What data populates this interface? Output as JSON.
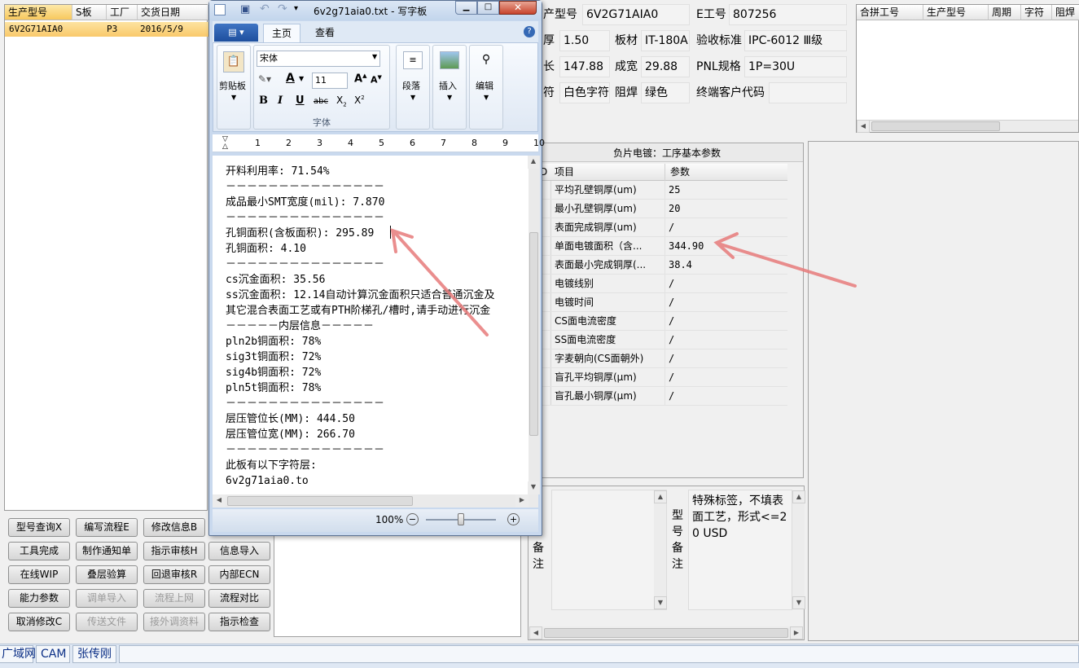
{
  "main_grid": {
    "headers": [
      "生产型号",
      "S板",
      "工厂",
      "交货日期"
    ],
    "row": {
      "model": "6V2G71AIA0",
      "s": "",
      "factory": "P3",
      "date": "2016/5/9"
    }
  },
  "buttons": [
    [
      "型号查询X",
      "编写流程E",
      "修改信息B",
      "帮助"
    ],
    [
      "工具完成",
      "制作通知单",
      "指示审核H",
      "信息导入"
    ],
    [
      "在线WIP",
      "叠层验算",
      "回退审核R",
      "内部ECN"
    ],
    [
      "能力参数",
      "调单导入",
      "流程上网",
      "流程对比"
    ],
    [
      "取消修改C",
      "传送文件",
      "接外调资料",
      "指示检查"
    ]
  ],
  "info_fields": {
    "prod_model_label": "产型号",
    "prod_model": "6V2G71AIA0",
    "e_no_label": "E工号",
    "e_no": "807256",
    "thick_label": "厚",
    "thick": "1.50",
    "material_label": "板材",
    "material": "IT-180A",
    "std_label": "验收标准",
    "std": "IPC-6012 Ⅲ级",
    "len_label": "长",
    "len": "147.88",
    "fin_w_label": "成宽",
    "fin_w": "29.88",
    "pnl_label": "PNL规格",
    "pnl": "1P=30U",
    "char_label": "符",
    "char": "白色字符",
    "mask_label": "阻焊",
    "mask": "绿色",
    "cust_label": "终端客户代码",
    "cust": ""
  },
  "merge_grid": {
    "headers": [
      "合拼工号",
      "生产型号",
      "周期",
      "字符",
      "阻焊"
    ]
  },
  "plating": {
    "title": "负片电镀：工序基本参数",
    "col_item": "项目",
    "col_param": "参数",
    "col0": "D",
    "rows": [
      [
        "平均孔壁铜厚(um)",
        "25"
      ],
      [
        "最小孔壁铜厚(um)",
        "20"
      ],
      [
        "表面完成铜厚(um)",
        "/"
      ],
      [
        "单面电镀面积（含...",
        "344.90"
      ],
      [
        "表面最小完成铜厚(...",
        "38.4"
      ],
      [
        "电镀线别",
        "/"
      ],
      [
        "电镀时间",
        "/"
      ],
      [
        "CS面电流密度",
        "/"
      ],
      [
        "SS面电流密度",
        "/"
      ],
      [
        "字麦朝向(CS面朝外)",
        "/"
      ],
      [
        "盲孔平均铜厚(μm)",
        "/"
      ],
      [
        "盲孔最小铜厚(μm)",
        "/"
      ]
    ]
  },
  "notes": {
    "remark_label": "备注",
    "model_remark_label": "型号备注",
    "model_remark": "特殊标签，不填表面工艺，形式<=20 USD"
  },
  "status": {
    "network": "广域网",
    "dept": "CAM",
    "user": "张传刚"
  },
  "wordpad": {
    "title": "6v2g71aia0.txt - 写字板",
    "tabs": [
      "主页",
      "查看"
    ],
    "font_name": "宋体",
    "font_size": "11",
    "groups": {
      "clipboard": "剪贴板",
      "font": "字体",
      "paragraph": "段落",
      "insert": "插入",
      "edit": "编辑"
    },
    "zoom": "100%",
    "lines": [
      "开料利用率: 71.54%",
      "－－－－－－－－－－－－－－－",
      "成品最小SMT宽度(mil): 7.870",
      "－－－－－－－－－－－－－－－",
      "孔铜面积(含板面积): 295.89",
      "孔铜面积: 4.10",
      "－－－－－－－－－－－－－－－",
      "cs沉金面积: 35.56",
      "ss沉金面积: 12.14自动计算沉金面积只适合普通沉金及",
      "其它混合表面工艺或有PTH阶梯孔/槽时,请手动进行沉金",
      "－－－－－内层信息－－－－－",
      "pln2b铜面积: 78%",
      "sig3t铜面积: 72%",
      "sig4b铜面积: 72%",
      "pln5t铜面积: 78%",
      "－－－－－－－－－－－－－－－",
      "层压管位长(MM): 444.50",
      "层压管位宽(MM): 266.70",
      "－－－－－－－－－－－－－－－",
      "此板有以下字符层:",
      "6v2g71aia0.to",
      "－－－－－－－－－－－－－－－"
    ],
    "ruler": [
      "1",
      "2",
      "3",
      "4",
      "5",
      "6",
      "7",
      "8",
      "9",
      "10"
    ]
  }
}
